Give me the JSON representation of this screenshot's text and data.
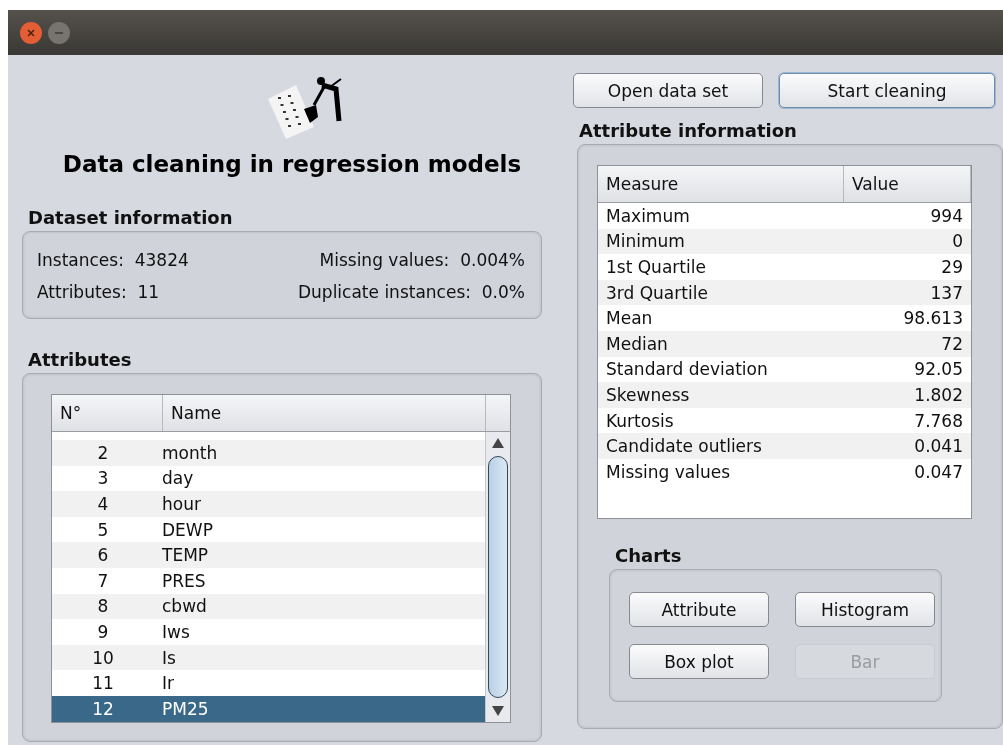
{
  "app": {
    "title": "Data cleaning in regression models"
  },
  "dataset_information": {
    "title": "Dataset information",
    "fields": [
      {
        "label": "Instances:",
        "value": "43824"
      },
      {
        "label": "Missing values:",
        "value": "0.004%"
      },
      {
        "label": "Attributes:",
        "value": "11"
      },
      {
        "label": "Duplicate instances:",
        "value": "0.0%"
      }
    ]
  },
  "attributes": {
    "title": "Attributes",
    "columns": [
      "N°",
      "Name"
    ],
    "rows": [
      {
        "number": "2",
        "name": "month",
        "selected": false
      },
      {
        "number": "3",
        "name": "day",
        "selected": false
      },
      {
        "number": "4",
        "name": "hour",
        "selected": false
      },
      {
        "number": "5",
        "name": "DEWP",
        "selected": false
      },
      {
        "number": "6",
        "name": "TEMP",
        "selected": false
      },
      {
        "number": "7",
        "name": "PRES",
        "selected": false
      },
      {
        "number": "8",
        "name": "cbwd",
        "selected": false
      },
      {
        "number": "9",
        "name": "Iws",
        "selected": false
      },
      {
        "number": "10",
        "name": "Is",
        "selected": false
      },
      {
        "number": "11",
        "name": "Ir",
        "selected": false
      },
      {
        "number": "12",
        "name": "PM25",
        "selected": true
      }
    ]
  },
  "toolbar": [
    {
      "label": "Open data set",
      "focused": false
    },
    {
      "label": "Start cleaning",
      "focused": true
    }
  ],
  "attribute_information": {
    "title": "Attribute information",
    "columns": [
      "Measure",
      "Value"
    ],
    "rows": [
      {
        "measure": "Maximum",
        "value": "994"
      },
      {
        "measure": "Minimum",
        "value": "0"
      },
      {
        "measure": "1st Quartile",
        "value": "29"
      },
      {
        "measure": "3rd Quartile",
        "value": "137"
      },
      {
        "measure": "Mean",
        "value": "98.613"
      },
      {
        "measure": "Median",
        "value": "72"
      },
      {
        "measure": "Standard deviation",
        "value": "92.05"
      },
      {
        "measure": "Skewness",
        "value": "1.802"
      },
      {
        "measure": "Kurtosis",
        "value": "7.768"
      },
      {
        "measure": "Candidate outliers",
        "value": "0.041"
      },
      {
        "measure": "Missing values",
        "value": "0.047"
      }
    ]
  },
  "charts": {
    "title": "Charts",
    "buttons": [
      {
        "label": "Attribute",
        "disabled": false
      },
      {
        "label": "Histogram",
        "disabled": false
      },
      {
        "label": "Box plot",
        "disabled": false
      },
      {
        "label": "Bar",
        "disabled": true
      }
    ]
  }
}
